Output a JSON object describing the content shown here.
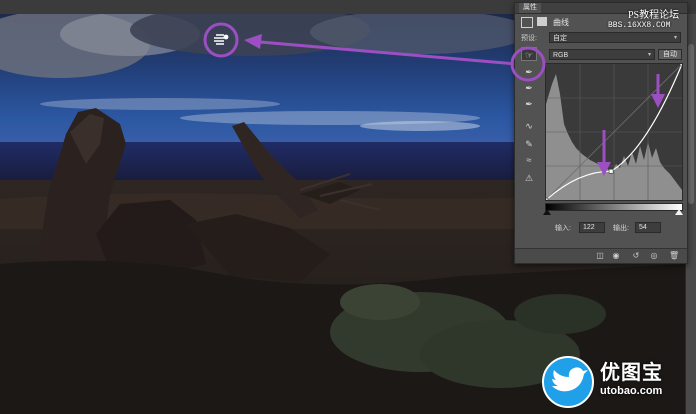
{
  "panel": {
    "tab_label": "属性",
    "title": "曲线",
    "preset_label": "预设:",
    "preset_value": "自定",
    "channel_value": "RGB",
    "auto_label": "自动",
    "input_label": "输入:",
    "input_value": "122",
    "output_label": "输出:",
    "output_value": "54",
    "tools": [
      "targeted-adjust-icon",
      "sample-black-eyedropper-icon",
      "sample-gray-eyedropper-icon",
      "sample-white-eyedropper-icon",
      "curve-edit-points-icon",
      "pencil-draw-icon",
      "smooth-curve-icon",
      "histogram-warning-icon"
    ],
    "footer_buttons": [
      "clip-to-layer-icon",
      "view-previous-icon",
      "reset-icon",
      "visibility-icon",
      "trash-icon"
    ],
    "curve_points": [
      {
        "input": 0,
        "output": 0
      },
      {
        "input": 122,
        "output": 54
      },
      {
        "input": 255,
        "output": 255
      }
    ]
  },
  "watermark": {
    "site_name": "PS教程论坛",
    "site_url": "BBS.16XX8.COM"
  },
  "logo": {
    "chinese": "优图宝",
    "english": "utobao.com"
  },
  "colors": {
    "annotation": "#9b4fc2",
    "panel_bg": "#525252",
    "logo_blue": "#1fa0e8"
  }
}
